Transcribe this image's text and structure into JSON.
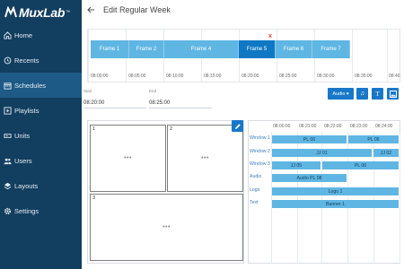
{
  "brand": {
    "name": "MuxLab",
    "tm": "™"
  },
  "sidebar": {
    "items": [
      {
        "label": "Home",
        "icon": "home-icon",
        "active": false
      },
      {
        "label": "Recents",
        "icon": "history-icon",
        "active": false
      },
      {
        "label": "Schedules",
        "icon": "calendar-icon",
        "active": true
      },
      {
        "label": "Playlists",
        "icon": "playlist-icon",
        "active": false
      },
      {
        "label": "Units",
        "icon": "units-icon",
        "active": false
      },
      {
        "label": "Users",
        "icon": "users-icon",
        "active": false
      },
      {
        "label": "Layouts",
        "icon": "layers-icon",
        "active": false
      },
      {
        "label": "Settings",
        "icon": "gear-icon",
        "active": false
      }
    ]
  },
  "header": {
    "title": "Edit Regular Week"
  },
  "timeline": {
    "frames": [
      "Frame 1",
      "Frame 2",
      "Frame 4",
      "Frame 5",
      "Frame 6",
      "Frame 7"
    ],
    "selected": "Frame 5",
    "close_symbol": "x",
    "ticks": [
      "08:00:00",
      "08:05:00",
      "08:10:00",
      "08:15:00",
      "08:20:00",
      "08:25:00",
      "08:30:00",
      "08:35:00",
      "08:40"
    ]
  },
  "start": {
    "label": "Start",
    "value": "08:20:00"
  },
  "end": {
    "label": "End",
    "value": "08:25:00"
  },
  "toolbar": {
    "audio_label": "Audio ▾",
    "music_icon": "♫",
    "text_icon": "T",
    "image_icon": "image-icon"
  },
  "preview": {
    "zones": [
      {
        "num": "1",
        "dots": "•••"
      },
      {
        "num": "2",
        "dots": "•••"
      },
      {
        "num": "3",
        "dots": "•••"
      }
    ]
  },
  "schedule": {
    "ticks": [
      "08:00:00",
      "08:21:00",
      "08:22:00",
      "08:23:00",
      "08:24:00"
    ],
    "rows": [
      {
        "label": "Window 1",
        "bars": [
          "PL 06",
          "PL 06"
        ]
      },
      {
        "label": "Window 2",
        "bars": [
          "JJ 01",
          "JJ 02"
        ]
      },
      {
        "label": "Window 3",
        "bars": [
          "JJ 05",
          "PL 06"
        ]
      },
      {
        "label": "Audio",
        "bars": [
          "Audio PL 08"
        ]
      },
      {
        "label": "Logo",
        "bars": [
          "Logo 1"
        ]
      },
      {
        "label": "Text",
        "bars": [
          "Banner 1"
        ]
      }
    ]
  },
  "colors": {
    "sidebar": "#123e5f",
    "active": "#1d5a86",
    "accent": "#1877c9",
    "bar": "#5fb6e3",
    "bar_selected": "#0f78c4"
  }
}
